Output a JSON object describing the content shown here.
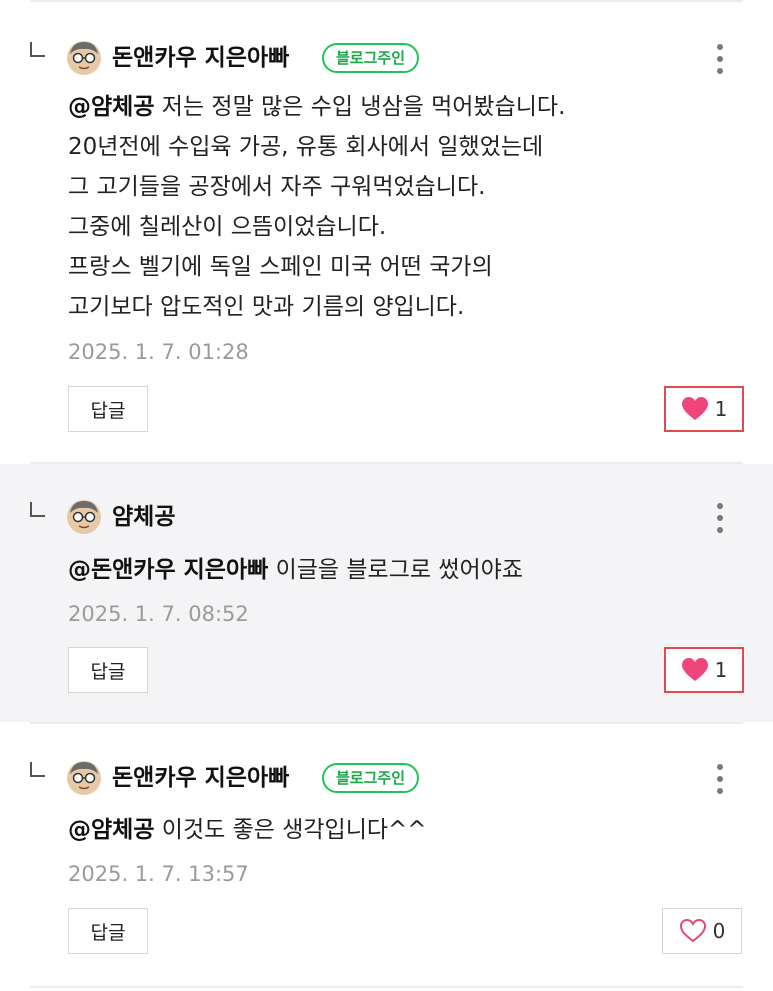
{
  "comments": [
    {
      "author": "돈앤카우 지은아빠",
      "badge": "블로그주인",
      "mention": "@얌체공",
      "lines": [
        " 저는 정말 많은 수입 냉삼을 먹어봤습니다.",
        "20년전에 수입육 가공, 유통 회사에서 일했었는데",
        "그 고기들을 공장에서 자주 구워먹었습니다.",
        "그중에 칠레산이 으뜸이었습니다.",
        "프랑스 벨기에 독일 스페인 미국 어떤 국가의",
        "고기보다 압도적인 맛과 기름의 양입니다."
      ],
      "date": "2025. 1. 7. 01:28",
      "reply_label": "답글",
      "like_count": "1",
      "liked": true
    },
    {
      "author": "얌체공",
      "mention": "@돈앤카우 지은아빠",
      "lines": [
        " 이글을 블로그로 썼어야죠"
      ],
      "date": "2025. 1. 7. 08:52",
      "reply_label": "답글",
      "like_count": "1",
      "liked": true
    },
    {
      "author": "돈앤카우 지은아빠",
      "badge": "블로그주인",
      "mention": "@얌체공",
      "lines": [
        " 이것도 좋은 생각입니다^^"
      ],
      "date": "2025. 1. 7. 13:57",
      "reply_label": "답글",
      "like_count": "0",
      "liked": false
    }
  ],
  "colors": {
    "badge_green": "#1ec65a",
    "like_pink": "#f0457a",
    "like_border_active": "#e34a4f",
    "highlight_bg": "#f4f4f6"
  }
}
